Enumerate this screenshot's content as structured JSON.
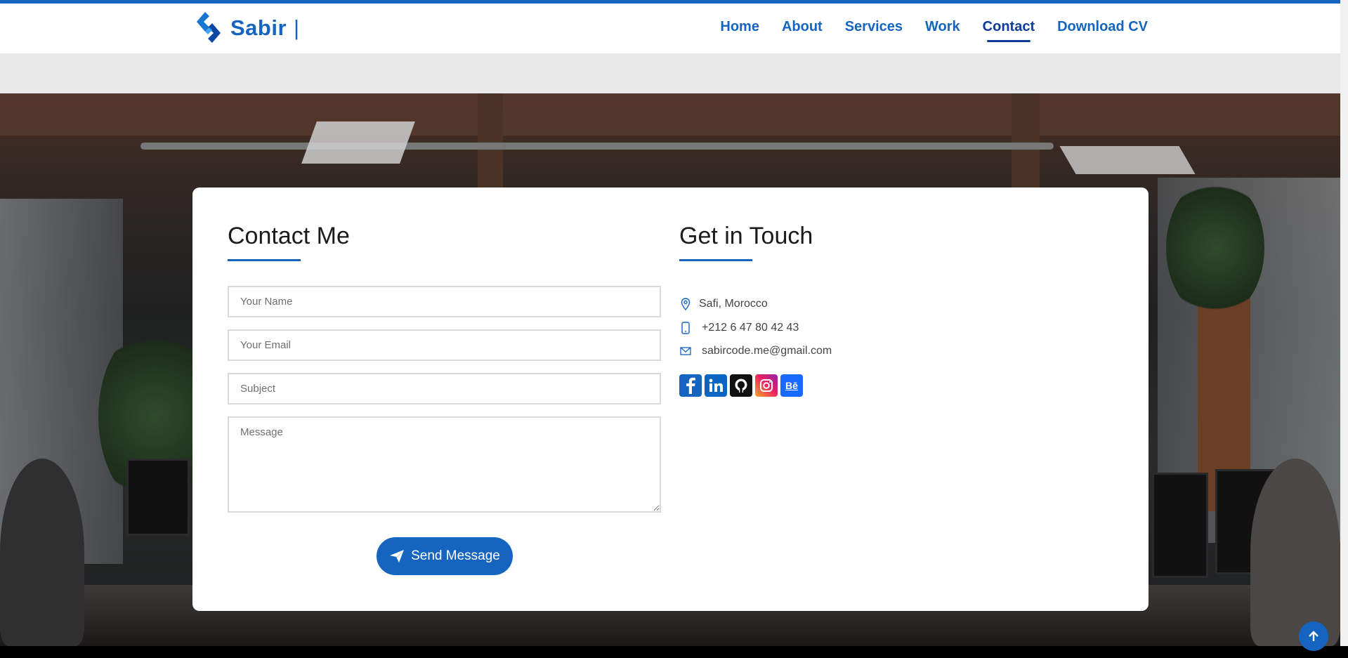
{
  "brand": {
    "name": "Sabir",
    "separator": "|"
  },
  "nav": [
    {
      "label": "Home",
      "active": false
    },
    {
      "label": "About",
      "active": false
    },
    {
      "label": "Services",
      "active": false
    },
    {
      "label": "Work",
      "active": false
    },
    {
      "label": "Contact",
      "active": true
    },
    {
      "label": "Download CV",
      "active": false
    }
  ],
  "contact_form": {
    "title": "Contact Me",
    "name_placeholder": "Your Name",
    "email_placeholder": "Your Email",
    "subject_placeholder": "Subject",
    "message_placeholder": "Message",
    "send_label": "Send Message"
  },
  "get_in_touch": {
    "title": "Get in Touch",
    "location": "Safi, Morocco",
    "phone": "+212 6 47 80 42 43",
    "email": "sabircode.me@gmail.com",
    "socials": [
      {
        "icon": "facebook-icon",
        "label": "f"
      },
      {
        "icon": "linkedin-icon",
        "label": "in"
      },
      {
        "icon": "github-icon",
        "label": ""
      },
      {
        "icon": "instagram-icon",
        "label": ""
      },
      {
        "icon": "behance-icon",
        "label": "Bē"
      }
    ]
  },
  "colors": {
    "accent": "#1565c0",
    "nav_active": "#0d3c9c"
  },
  "icons": {
    "scroll_top": "arrow-up-icon"
  }
}
